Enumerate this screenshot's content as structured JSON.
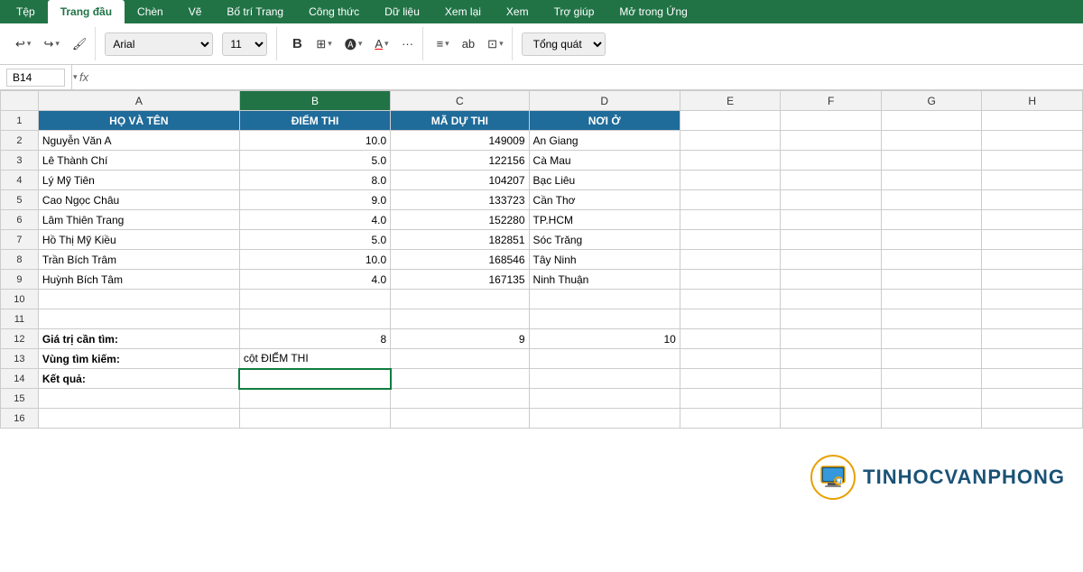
{
  "ribbon": {
    "tabs": [
      "Tệp",
      "Trang đầu",
      "Chèn",
      "Vẽ",
      "Bố trí Trang",
      "Công thức",
      "Dữ liệu",
      "Xem lại",
      "Xem",
      "Trợ giúp",
      "Mở trong Ứng"
    ],
    "active_tab": "Trang đầu"
  },
  "toolbar": {
    "font": "Arial",
    "size": "11",
    "format": "Tổng quát"
  },
  "formula_bar": {
    "cell_ref": "B14",
    "fx": "fx"
  },
  "columns": {
    "row_num": "",
    "a": "A",
    "b": "B",
    "c": "C",
    "d": "D",
    "e": "E",
    "f": "F",
    "g": "G",
    "h": "H"
  },
  "rows": [
    {
      "num": "1",
      "a": "HỌ VÀ TÊN",
      "b": "ĐIỂM THI",
      "c": "MÃ DỰ THI",
      "d": "NƠI Ở",
      "is_header": true
    },
    {
      "num": "2",
      "a": "Nguyễn Văn A",
      "b": "10.0",
      "c": "149009",
      "d": "An Giang"
    },
    {
      "num": "3",
      "a": "Lê Thành Chí",
      "b": "5.0",
      "c": "122156",
      "d": "Cà Mau"
    },
    {
      "num": "4",
      "a": "Lý Mỹ Tiên",
      "b": "8.0",
      "c": "104207",
      "d": "Bạc Liêu"
    },
    {
      "num": "5",
      "a": "Cao Ngọc Châu",
      "b": "9.0",
      "c": "133723",
      "d": "Cần Thơ"
    },
    {
      "num": "6",
      "a": "Lâm Thiên Trang",
      "b": "4.0",
      "c": "152280",
      "d": "TP.HCM"
    },
    {
      "num": "7",
      "a": "Hồ Thị Mỹ Kiều",
      "b": "5.0",
      "c": "182851",
      "d": "Sóc Trăng"
    },
    {
      "num": "8",
      "a": "Trần Bích Trâm",
      "b": "10.0",
      "c": "168546",
      "d": "Tây Ninh"
    },
    {
      "num": "9",
      "a": "Huỳnh Bích Tâm",
      "b": "4.0",
      "c": "167135",
      "d": "Ninh Thuận"
    },
    {
      "num": "10",
      "a": "",
      "b": "",
      "c": "",
      "d": ""
    },
    {
      "num": "11",
      "a": "",
      "b": "",
      "c": "",
      "d": ""
    },
    {
      "num": "12",
      "a": "Giá trị cần tìm:",
      "b": "8",
      "c": "9",
      "d": "10"
    },
    {
      "num": "13",
      "a": "Vùng tìm kiếm:",
      "b": "cột ĐIỂM THI",
      "c": "",
      "d": ""
    },
    {
      "num": "14",
      "a": "Kết quả:",
      "b": "",
      "c": "",
      "d": "",
      "selected_b": true
    },
    {
      "num": "15",
      "a": "",
      "b": "",
      "c": "",
      "d": ""
    },
    {
      "num": "16",
      "a": "",
      "b": "",
      "c": "",
      "d": ""
    }
  ],
  "watermark": {
    "icon": "🖥",
    "text": "TINHOCVANPHONG"
  }
}
